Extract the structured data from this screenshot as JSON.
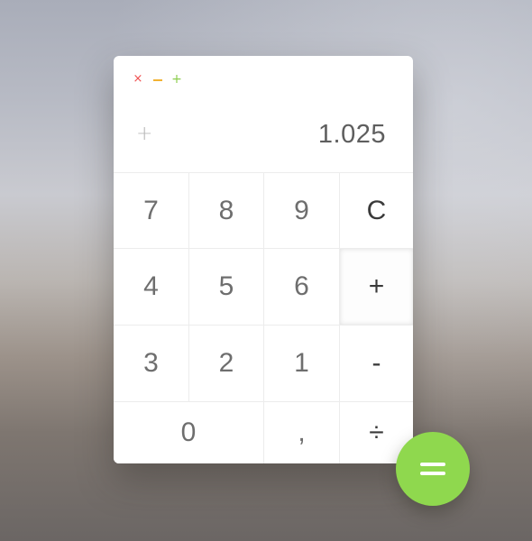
{
  "window": {
    "close_glyph": "×",
    "maximize_glyph": "+",
    "close_color": "#ef4f4f",
    "minimize_color": "#f2b233",
    "maximize_color": "#8ccd4d"
  },
  "display": {
    "operator": "+",
    "value": "1.025"
  },
  "keypad": {
    "rows": [
      [
        "7",
        "8",
        "9",
        "C"
      ],
      [
        "4",
        "5",
        "6",
        "+"
      ],
      [
        "3",
        "2",
        "1",
        "-"
      ],
      [
        "0",
        ",",
        "÷"
      ]
    ],
    "active_key": "+"
  },
  "equals": {
    "icon": "equals-icon",
    "color": "#8fd84e"
  }
}
